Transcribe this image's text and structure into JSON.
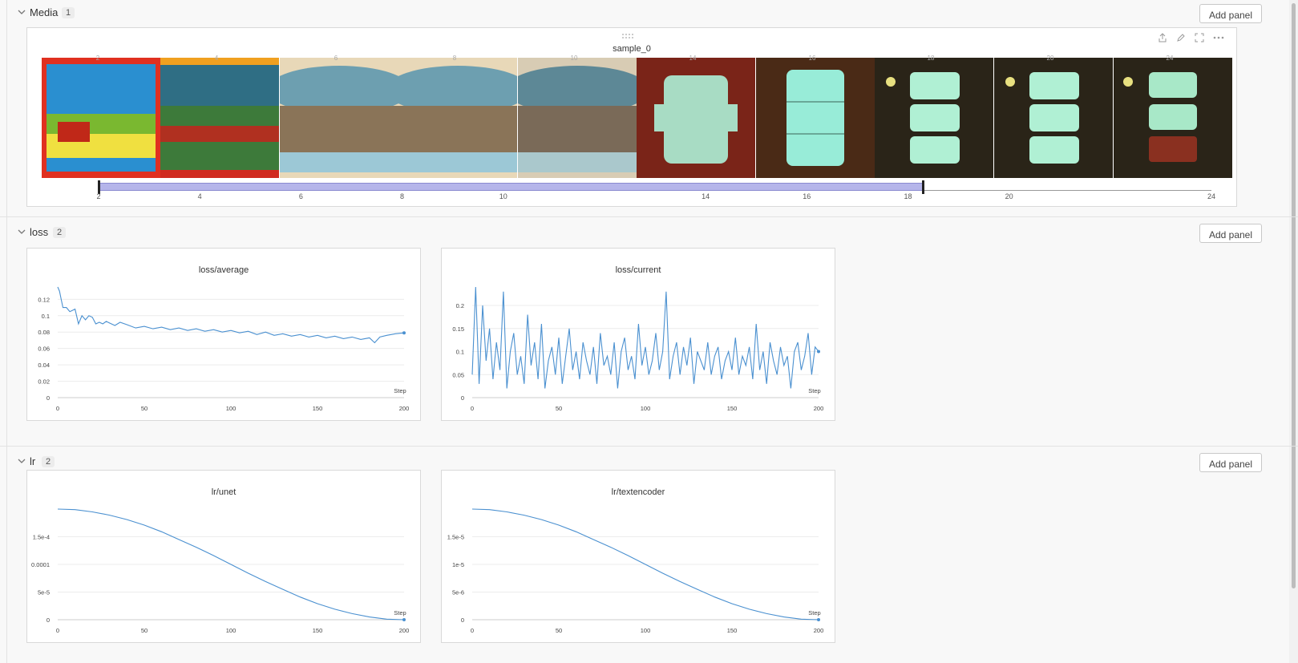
{
  "sections": {
    "media": {
      "title": "Media",
      "count": "1",
      "add_label": "Add panel"
    },
    "loss": {
      "title": "loss",
      "count": "2",
      "add_label": "Add panel"
    },
    "lr": {
      "title": "lr",
      "count": "2",
      "add_label": "Add panel"
    }
  },
  "media_panel": {
    "title": "sample_0",
    "thumb_steps": [
      "2",
      "4",
      "6",
      "8",
      "10",
      "14",
      "16",
      "18",
      "20",
      "24"
    ],
    "slider_ticks": [
      "2",
      "4",
      "6",
      "8",
      "10",
      "14",
      "16",
      "18",
      "20",
      "24"
    ],
    "slider_range": [
      2,
      18.3
    ],
    "thumbs": [
      {
        "style": "colorful-red-frame"
      },
      {
        "style": "landscape-orange-top"
      },
      {
        "style": "glass-bowl"
      },
      {
        "style": "glass-bowl"
      },
      {
        "style": "glass-bowl-dim"
      },
      {
        "style": "component-red"
      },
      {
        "style": "component-brown"
      },
      {
        "style": "component-dark"
      },
      {
        "style": "component-dark"
      },
      {
        "style": "component-dark-red"
      }
    ]
  },
  "icons": {
    "share": "share-icon",
    "edit": "edit-icon",
    "expand": "fullscreen-icon",
    "more": "more-icon",
    "drag": "drag-handle-icon",
    "chevron": "chevron-down-icon"
  },
  "colors": {
    "line": "#4a90d0",
    "slider": "#b5b5ea"
  },
  "chart_data": [
    {
      "type": "line",
      "title": "loss/average",
      "xlabel": "Step",
      "ylabel": "",
      "xlim": [
        0,
        200
      ],
      "ylim": [
        0,
        0.135
      ],
      "yticks": [
        "0",
        "0.02",
        "0.04",
        "0.06",
        "0.08",
        "0.1",
        "0.12"
      ],
      "xticks": [
        "0",
        "50",
        "100",
        "150",
        "200"
      ],
      "series": [
        {
          "x": [
            0,
            1,
            2,
            3,
            5,
            7,
            10,
            12,
            14,
            16,
            18,
            20,
            22,
            24,
            26,
            28,
            30,
            33,
            36,
            40,
            45,
            50,
            55,
            60,
            65,
            70,
            75,
            80,
            85,
            90,
            95,
            100,
            105,
            110,
            115,
            120,
            125,
            130,
            135,
            140,
            145,
            150,
            155,
            160,
            165,
            170,
            175,
            180,
            183,
            186,
            190,
            195,
            200
          ],
          "y": [
            0.135,
            0.13,
            0.12,
            0.11,
            0.11,
            0.105,
            0.108,
            0.09,
            0.1,
            0.095,
            0.1,
            0.098,
            0.09,
            0.092,
            0.09,
            0.093,
            0.091,
            0.088,
            0.092,
            0.089,
            0.085,
            0.087,
            0.084,
            0.086,
            0.083,
            0.085,
            0.082,
            0.084,
            0.081,
            0.083,
            0.08,
            0.082,
            0.079,
            0.081,
            0.077,
            0.08,
            0.076,
            0.078,
            0.075,
            0.077,
            0.074,
            0.076,
            0.073,
            0.075,
            0.072,
            0.074,
            0.071,
            0.073,
            0.067,
            0.074,
            0.076,
            0.078,
            0.079
          ]
        }
      ]
    },
    {
      "type": "line",
      "title": "loss/current",
      "xlabel": "Step",
      "ylabel": "",
      "xlim": [
        0,
        200
      ],
      "ylim": [
        0,
        0.24
      ],
      "yticks": [
        "0",
        "0.05",
        "0.1",
        "0.15",
        "0.2"
      ],
      "xticks": [
        "0",
        "50",
        "100",
        "150",
        "200"
      ],
      "series": [
        {
          "x": [
            0,
            2,
            4,
            6,
            8,
            10,
            12,
            14,
            16,
            18,
            20,
            22,
            24,
            26,
            28,
            30,
            32,
            34,
            36,
            38,
            40,
            42,
            44,
            46,
            48,
            50,
            52,
            54,
            56,
            58,
            60,
            62,
            64,
            66,
            68,
            70,
            72,
            74,
            76,
            78,
            80,
            82,
            84,
            86,
            88,
            90,
            92,
            94,
            96,
            98,
            100,
            102,
            104,
            106,
            108,
            110,
            112,
            114,
            116,
            118,
            120,
            122,
            124,
            126,
            128,
            130,
            132,
            134,
            136,
            138,
            140,
            142,
            144,
            146,
            148,
            150,
            152,
            154,
            156,
            158,
            160,
            162,
            164,
            166,
            168,
            170,
            172,
            174,
            176,
            178,
            180,
            182,
            184,
            186,
            188,
            190,
            192,
            194,
            196,
            198,
            200
          ],
          "y": [
            0.05,
            0.24,
            0.03,
            0.2,
            0.08,
            0.15,
            0.04,
            0.12,
            0.06,
            0.23,
            0.02,
            0.1,
            0.14,
            0.05,
            0.09,
            0.03,
            0.18,
            0.07,
            0.12,
            0.04,
            0.16,
            0.02,
            0.08,
            0.11,
            0.05,
            0.13,
            0.03,
            0.09,
            0.15,
            0.06,
            0.1,
            0.04,
            0.12,
            0.08,
            0.05,
            0.11,
            0.03,
            0.14,
            0.07,
            0.09,
            0.05,
            0.12,
            0.02,
            0.1,
            0.13,
            0.06,
            0.09,
            0.04,
            0.16,
            0.07,
            0.11,
            0.05,
            0.08,
            0.14,
            0.06,
            0.1,
            0.23,
            0.04,
            0.09,
            0.12,
            0.05,
            0.11,
            0.07,
            0.13,
            0.03,
            0.1,
            0.08,
            0.06,
            0.12,
            0.05,
            0.09,
            0.11,
            0.04,
            0.08,
            0.1,
            0.06,
            0.13,
            0.05,
            0.09,
            0.07,
            0.11,
            0.04,
            0.16,
            0.06,
            0.1,
            0.03,
            0.12,
            0.08,
            0.05,
            0.11,
            0.07,
            0.09,
            0.02,
            0.1,
            0.12,
            0.06,
            0.09,
            0.14,
            0.05,
            0.11,
            0.1
          ]
        }
      ]
    },
    {
      "type": "line",
      "title": "lr/unet",
      "xlabel": "Step",
      "ylabel": "",
      "xlim": [
        0,
        200
      ],
      "ylim": [
        0,
        0.0002
      ],
      "yticks": [
        "0",
        "5e-5",
        "0.0001",
        "1.5e-4"
      ],
      "xticks": [
        "0",
        "50",
        "100",
        "150",
        "200"
      ],
      "series": [
        {
          "x": [
            0,
            10,
            20,
            30,
            40,
            50,
            60,
            70,
            80,
            90,
            100,
            110,
            120,
            130,
            140,
            150,
            160,
            170,
            180,
            190,
            200
          ],
          "y": [
            0.0002,
            0.000199,
            0.000195,
            0.000189,
            0.000181,
            0.000171,
            0.000159,
            0.000145,
            0.000131,
            0.000116,
            0.0001,
            8.4e-05,
            6.9e-05,
            5.5e-05,
            4.1e-05,
            2.9e-05,
            1.9e-05,
            1.1e-05,
            5e-06,
            1e-06,
            0.0
          ]
        }
      ]
    },
    {
      "type": "line",
      "title": "lr/textencoder",
      "xlabel": "Step",
      "ylabel": "",
      "xlim": [
        0,
        200
      ],
      "ylim": [
        0,
        2e-05
      ],
      "yticks": [
        "0",
        "5e-6",
        "1e-5",
        "1.5e-5"
      ],
      "xticks": [
        "0",
        "50",
        "100",
        "150",
        "200"
      ],
      "series": [
        {
          "x": [
            0,
            10,
            20,
            30,
            40,
            50,
            60,
            70,
            80,
            90,
            100,
            110,
            120,
            130,
            140,
            150,
            160,
            170,
            180,
            190,
            200
          ],
          "y": [
            2e-05,
            1.99e-05,
            1.95e-05,
            1.89e-05,
            1.81e-05,
            1.71e-05,
            1.59e-05,
            1.45e-05,
            1.31e-05,
            1.16e-05,
            1e-05,
            8.4e-06,
            6.9e-06,
            5.5e-06,
            4.1e-06,
            2.9e-06,
            1.9e-06,
            1.1e-06,
            5e-07,
            1e-07,
            0.0
          ]
        }
      ]
    }
  ]
}
